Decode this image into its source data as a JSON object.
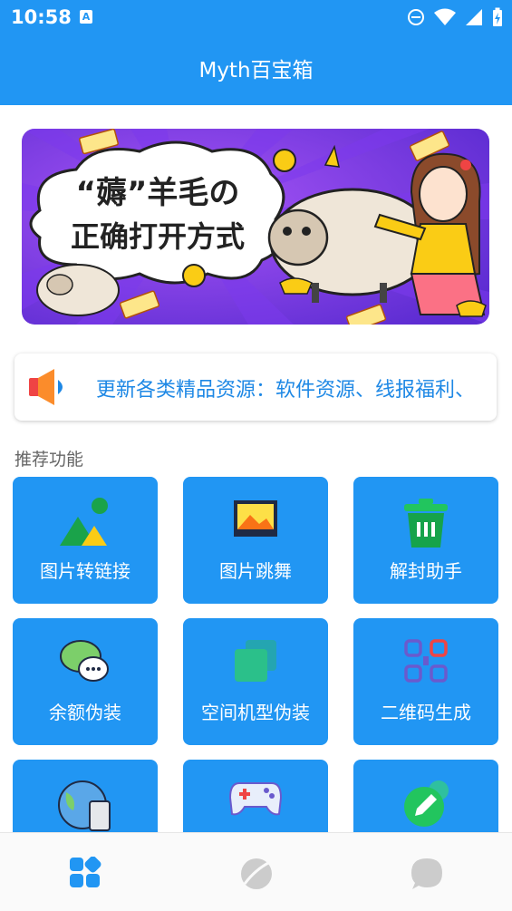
{
  "status_bar": {
    "time": "10:58",
    "notification_icon": "A"
  },
  "app_bar": {
    "title": "Myth百宝箱"
  },
  "banner": {
    "headline_part1": "“薅”羊毛の",
    "headline_part2": "正确打开方式"
  },
  "notice": {
    "text": "更新各类精品资源：软件资源、线报福利、"
  },
  "section": {
    "title": "推荐功能"
  },
  "features": [
    {
      "label": "图片转链接",
      "icon": "image-mountain-icon"
    },
    {
      "label": "图片跳舞",
      "icon": "picture-frame-icon"
    },
    {
      "label": "解封助手",
      "icon": "trash-bin-icon"
    },
    {
      "label": "余额伪装",
      "icon": "chat-bubbles-icon"
    },
    {
      "label": "空间机型伪装",
      "icon": "stacked-squares-icon"
    },
    {
      "label": "二维码生成",
      "icon": "qr-code-icon"
    },
    {
      "label": "",
      "icon": "globe-device-icon"
    },
    {
      "label": "",
      "icon": "gamepad-icon"
    },
    {
      "label": "",
      "icon": "edit-pencil-icon"
    }
  ],
  "bottom_nav": [
    {
      "icon": "apps-grid-icon",
      "active": true
    },
    {
      "icon": "planet-icon",
      "active": false
    },
    {
      "icon": "chat-icon",
      "active": false
    }
  ],
  "colors": {
    "primary": "#2196f3",
    "notice_text": "#1e88e5",
    "nav_inactive": "#cccccc"
  }
}
